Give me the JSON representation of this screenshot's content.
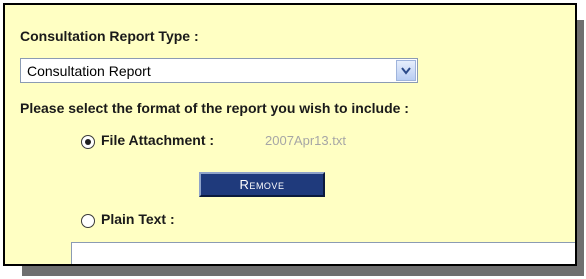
{
  "form": {
    "report_type_label": "Consultation Report Type :",
    "report_type_selected": "Consultation Report",
    "format_prompt": "Please select the format of the report you wish to include :",
    "options": {
      "file_attachment": {
        "label": "File Attachment :",
        "selected": true,
        "filename": "2007Apr13.txt",
        "remove_label": "Remove"
      },
      "plain_text": {
        "label": "Plain Text :",
        "selected": false,
        "value": ""
      }
    }
  },
  "icons": {
    "select_arrow": "chevron-down-icon",
    "radio_selected": "radio-selected-icon",
    "radio_unselected": "radio-unselected-icon"
  },
  "colors": {
    "panel_background": "#ffffc3",
    "button_background": "#1f3a7c",
    "filename_text": "#a6a6a6"
  }
}
